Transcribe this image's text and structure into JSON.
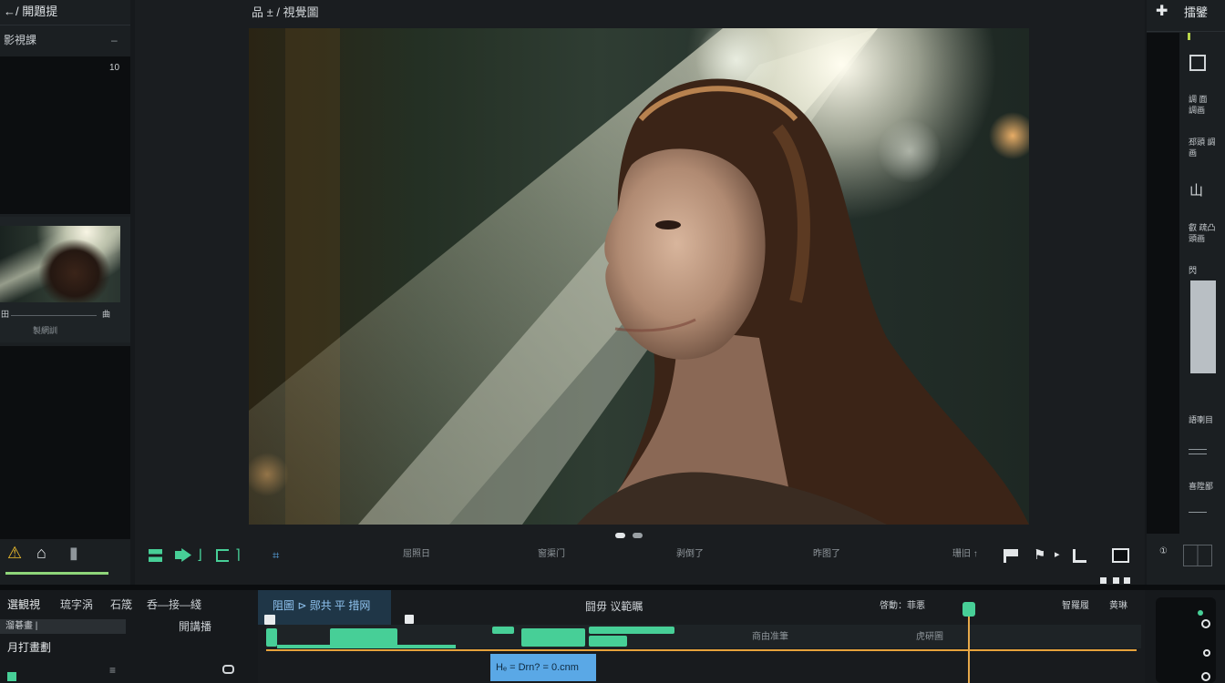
{
  "left_panel": {
    "title": "←/ 開題提",
    "section_label": "影視課",
    "section_collapse": "–",
    "count_badge": "10",
    "thumb_left": "田",
    "thumb_right": "曲",
    "thumb_caption": "製網訓",
    "tabs": [
      "⚠",
      "⌂",
      "▮"
    ]
  },
  "viewer": {
    "breadcrumb": "品 ± / 視覺圖",
    "page_dots": 2
  },
  "playback": {
    "status_items": [
      "屈照日",
      "窗渠门",
      "剥倒了",
      "昨图了",
      "珊旧 ↑"
    ]
  },
  "right_panel": {
    "add_label": "✚",
    "title": "擂鐾",
    "labels": [
      "調 面 調画",
      "邳頭 調画",
      "山",
      "叡 疏凸 頭画",
      "閃",
      "語喇目",
      "喜陞鄙"
    ],
    "bottom_icon": "①"
  },
  "bottom_left": {
    "tabs": [
      "選観視",
      "琉字涡",
      "石筬",
      "呑—接—綫"
    ],
    "tag": "溜碁畫 |",
    "row_label": "月打畫劃",
    "side_label": "開講播"
  },
  "timeline": {
    "header_tab": "阻圖 ⊳ 郧共 平 措网",
    "center_label": "闘毋 议範瞩",
    "right_label_1": "啓動：菲悪",
    "right_label_2": "智羅履",
    "right_label_3": "黄琳",
    "track_label_1": "商由准筆",
    "track_label_2": "虎硏圖",
    "clip_label": "Hₑ = Drn? = 0.cnm"
  },
  "colors": {
    "accent_green": "#47cf97",
    "timeline_blue": "#5aa8e6",
    "playhead_orange": "#e7a33b"
  }
}
